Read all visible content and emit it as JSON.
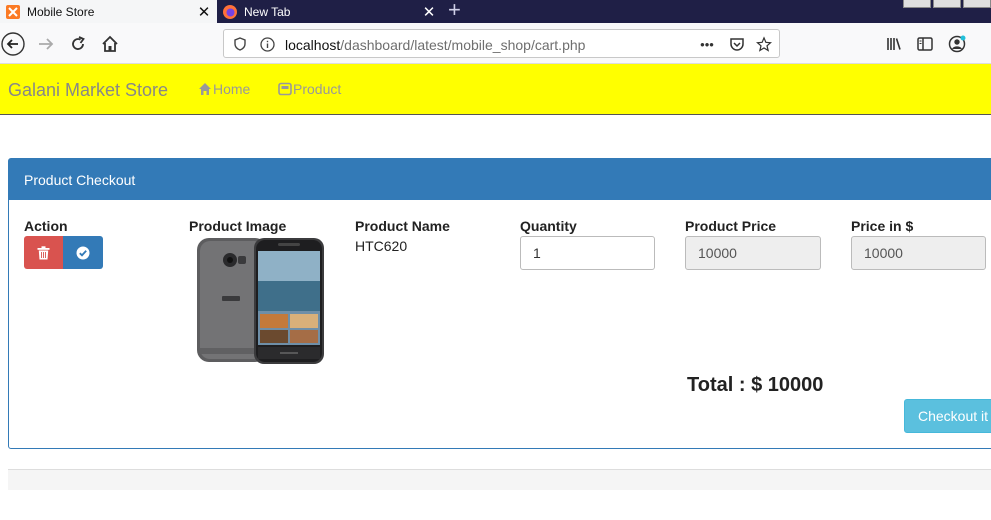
{
  "browser": {
    "tabs": [
      {
        "title": "Mobile Store",
        "active": true
      },
      {
        "title": "New Tab",
        "active": false
      }
    ],
    "url": {
      "host": "localhost",
      "path": "/dashboard/latest/mobile_shop/cart.php"
    },
    "url_menu": "•••"
  },
  "site": {
    "brand": "Galani Market Store",
    "nav": [
      {
        "label": "Home",
        "icon": "home-icon"
      },
      {
        "label": "Product",
        "icon": "product-icon"
      }
    ],
    "header_color": "#ffff00"
  },
  "checkout": {
    "panel_title": "Product Checkout",
    "columns": {
      "action": "Action",
      "image": "Product Image",
      "name": "Product Name",
      "quantity": "Quantity",
      "price": "Product Price",
      "price_usd": "Price in $"
    },
    "item": {
      "name": "HTC620",
      "quantity": "1",
      "price": "10000",
      "price_usd": "10000"
    },
    "total": "Total : $ 10000",
    "checkout_label": "Checkout it"
  },
  "colors": {
    "primary": "#337ab7",
    "danger": "#d9534f",
    "info": "#5bc0de"
  }
}
